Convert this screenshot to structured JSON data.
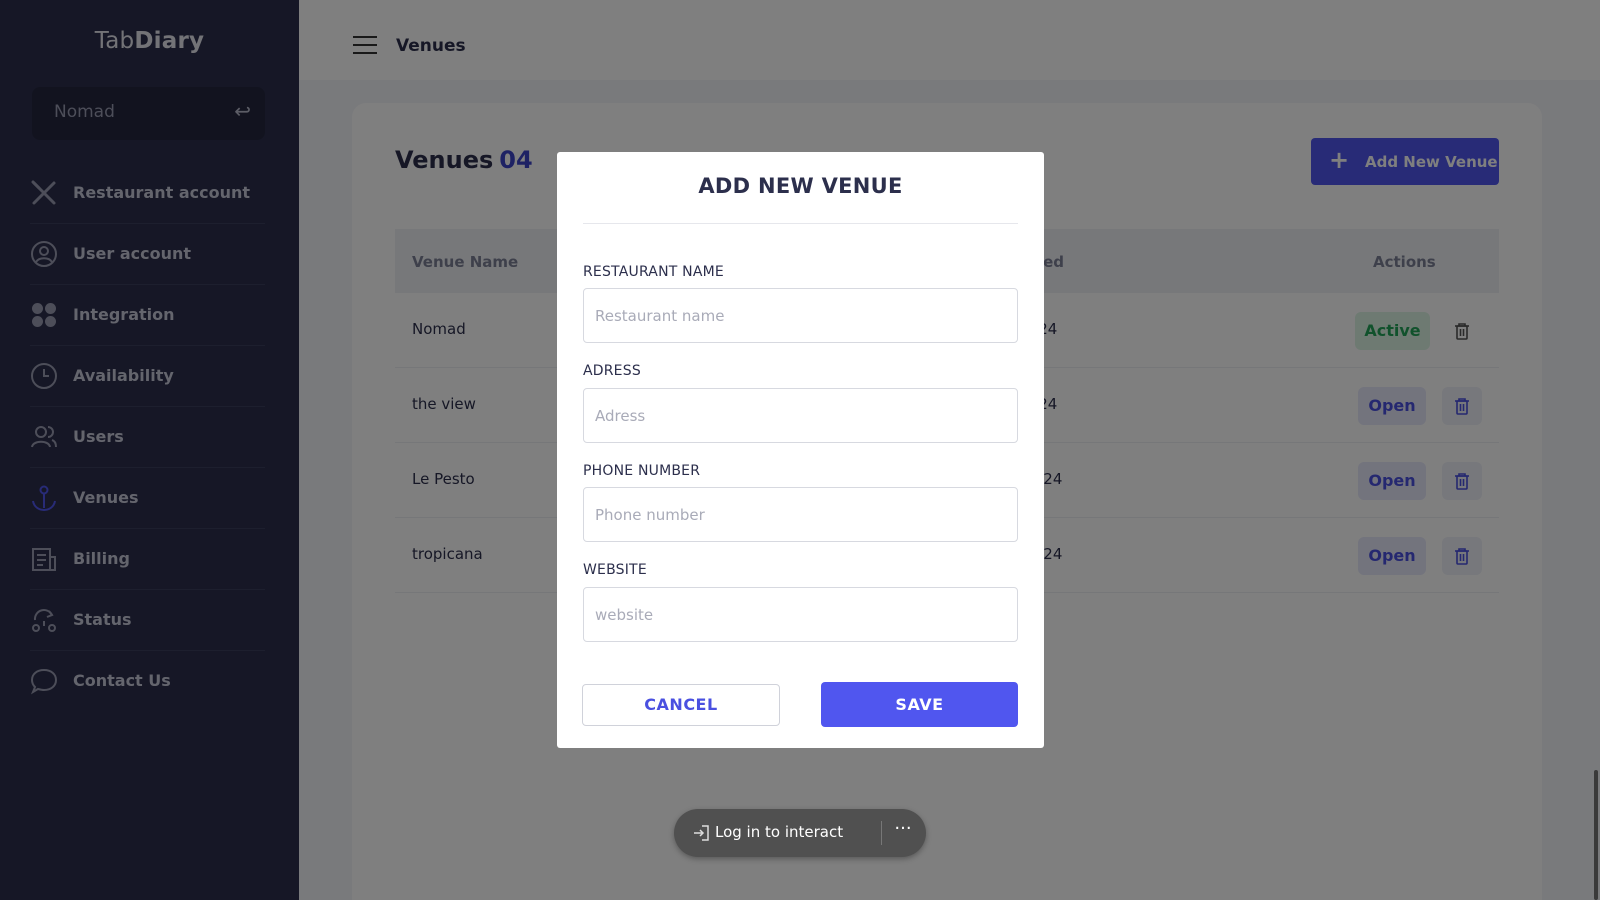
{
  "brand": {
    "light": "Tab",
    "bold": "Diary"
  },
  "sidebar": {
    "venue_selector": {
      "value": "Nomad",
      "swap_icon": "switch-arrow-icon"
    },
    "items": [
      {
        "label": "Restaurant account",
        "icon": "utensils-icon"
      },
      {
        "label": "User account",
        "icon": "user-circle-icon"
      },
      {
        "label": "Integration",
        "icon": "grid-dots-icon"
      },
      {
        "label": "Availability",
        "icon": "clock-icon"
      },
      {
        "label": "Users",
        "icon": "users-icon"
      },
      {
        "label": "Venues",
        "icon": "anchor-icon",
        "active": true
      },
      {
        "label": "Billing",
        "icon": "receipt-icon"
      },
      {
        "label": "Status",
        "icon": "status-icon"
      },
      {
        "label": "Contact Us",
        "icon": "chat-bubble-icon"
      }
    ]
  },
  "topbar": {
    "title": "Venues"
  },
  "venues": {
    "heading": "Venues",
    "count": "04",
    "add_button": "Add New Venue",
    "columns": {
      "name": "Venue Name",
      "visited": "t Visited",
      "actions": "Actions"
    },
    "rows": [
      {
        "name": "Nomad",
        "date": "06/2024",
        "status": "Active"
      },
      {
        "name": "the view",
        "date": "06/2024",
        "status": "Open"
      },
      {
        "name": "Le Pesto",
        "date": "/05/2024",
        "status": "Open"
      },
      {
        "name": "tropicana",
        "date": "/05/2024",
        "status": "Open"
      }
    ]
  },
  "modal": {
    "title": "ADD NEW VENUE",
    "fields": {
      "restaurant_name": {
        "label": "RESTAURANT NAME",
        "placeholder": "Restaurant name",
        "value": ""
      },
      "address": {
        "label": "ADRESS",
        "placeholder": "Adress",
        "value": ""
      },
      "phone": {
        "label": "PHONE NUMBER",
        "placeholder": "Phone number",
        "value": ""
      },
      "website": {
        "label": "WEBSITE",
        "placeholder": "website",
        "value": ""
      }
    },
    "cancel": "CANCEL",
    "save": "SAVE"
  },
  "pill": {
    "label": "Log in to interact",
    "more": "···"
  },
  "colors": {
    "sidebar": "#2c2f4c",
    "accent": "#5056ef",
    "active_green": "#22a559"
  }
}
